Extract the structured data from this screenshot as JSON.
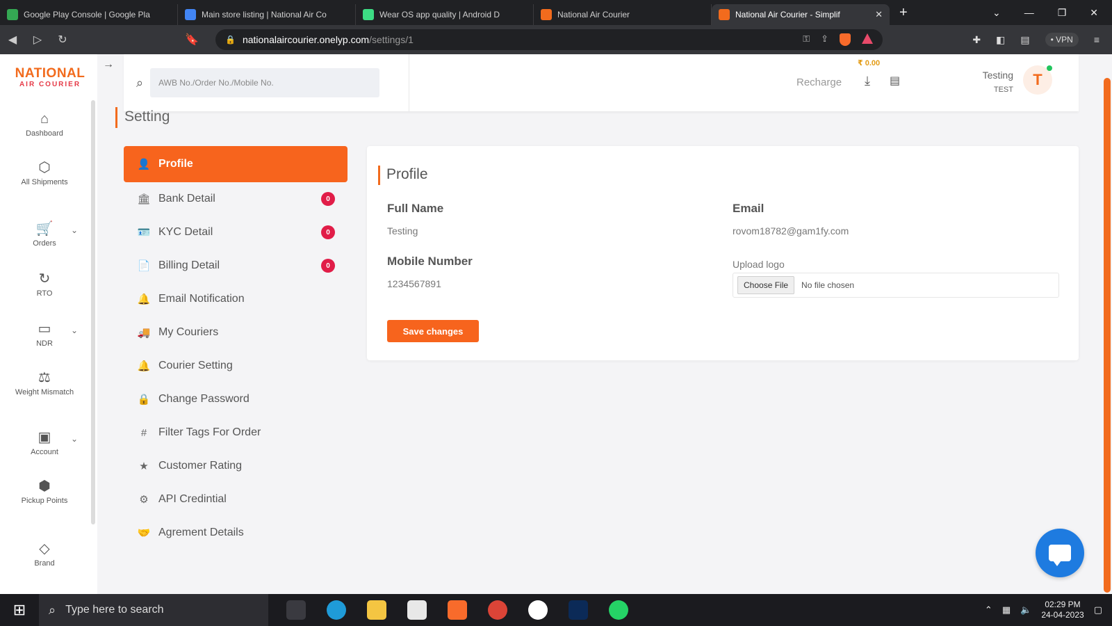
{
  "browser": {
    "tabs": [
      {
        "title": "Google Play Console | Google Pla",
        "color": "#34a853"
      },
      {
        "title": "Main store listing | National Air Co",
        "color": "#4285f4"
      },
      {
        "title": "Wear OS app quality | Android D",
        "color": "#3ddc84"
      },
      {
        "title": "National Air Courier",
        "color": "#f26b1d"
      },
      {
        "title": "National Air Courier - Simplif",
        "color": "#f26b1d"
      }
    ],
    "new_tab": "+",
    "url_domain": "nationalaircourier.onelyp.com",
    "url_path": "/settings/1",
    "vpn_label": "• VPN"
  },
  "brand": {
    "line1": "NATIONAL",
    "line2": "AIR COURIER"
  },
  "sidebar": {
    "items": [
      {
        "label": "Dashboard",
        "icon": "⌂"
      },
      {
        "label": "All Shipments",
        "icon": "⬡"
      },
      {
        "label": "Orders",
        "icon": "🛒"
      },
      {
        "label": "RTO",
        "icon": "↻"
      },
      {
        "label": "NDR",
        "icon": "▭"
      },
      {
        "label": "Weight Mismatch",
        "icon": "⚖"
      },
      {
        "label": "Account",
        "icon": "▣"
      },
      {
        "label": "Pickup Points",
        "icon": "⬢"
      },
      {
        "label": "Brand",
        "icon": "◇"
      }
    ],
    "chevron": "⌄"
  },
  "header": {
    "search_placeholder": "AWB No./Order No./Mobile No.",
    "balance": "₹ 0.00",
    "recharge": "Recharge",
    "user_name": "Testing",
    "user_role": "TEST",
    "avatar_initial": "T"
  },
  "page": {
    "title": "Setting"
  },
  "settings_menu": [
    {
      "label": "Profile",
      "icon": "👤",
      "badge": ""
    },
    {
      "label": "Bank Detail",
      "icon": "🏛",
      "badge": "0"
    },
    {
      "label": "KYC Detail",
      "icon": "🪪",
      "badge": "0"
    },
    {
      "label": "Billing Detail",
      "icon": "📄",
      "badge": "0"
    },
    {
      "label": "Email Notification",
      "icon": "🔔",
      "badge": ""
    },
    {
      "label": "My Couriers",
      "icon": "🚚",
      "badge": ""
    },
    {
      "label": "Courier Setting",
      "icon": "🔔",
      "badge": ""
    },
    {
      "label": "Change Password",
      "icon": "🔒",
      "badge": ""
    },
    {
      "label": "Filter Tags For Order",
      "icon": "#",
      "badge": ""
    },
    {
      "label": "Customer Rating",
      "icon": "★",
      "badge": ""
    },
    {
      "label": "API Credintial",
      "icon": "⚙",
      "badge": ""
    },
    {
      "label": "Agrement Details",
      "icon": "🤝",
      "badge": ""
    }
  ],
  "profile": {
    "title": "Profile",
    "full_name_label": "Full Name",
    "full_name": "Testing",
    "email_label": "Email",
    "email": "rovom18782@gam1fy.com",
    "mobile_label": "Mobile Number",
    "mobile": "1234567891",
    "upload_label": "Upload logo",
    "choose_file": "Choose File",
    "no_file": "No file chosen",
    "save": "Save changes"
  },
  "taskbar": {
    "search_placeholder": "Type here to search",
    "time": "02:29 PM",
    "date": "24-04-2023"
  },
  "colors": {
    "accent": "#f7641d",
    "badge": "#e11d48",
    "chat": "#1e7be0"
  }
}
